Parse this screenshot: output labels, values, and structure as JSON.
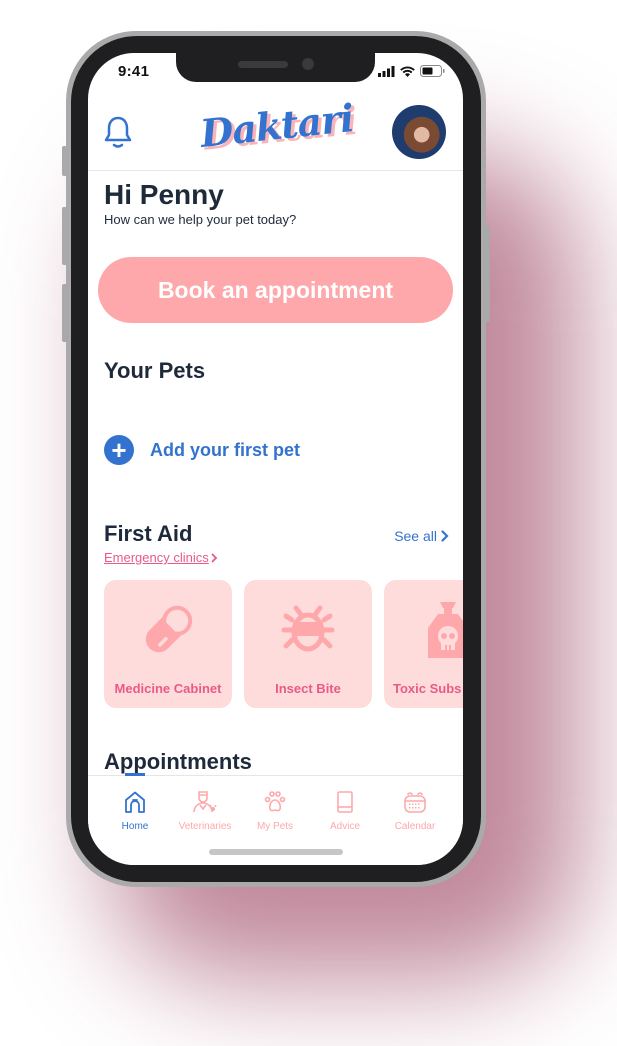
{
  "status_bar": {
    "time": "9:41"
  },
  "header": {
    "logo_text": "Daktari",
    "notification_icon": "bell-icon",
    "avatar_icon": "user-avatar"
  },
  "greeting": {
    "title": "Hi Penny",
    "subtitle": "How can we help your pet today?"
  },
  "book_button": {
    "label": "Book an appointment"
  },
  "pets": {
    "title": "Your Pets",
    "add_label": "Add your first pet",
    "add_icon": "plus-circle-icon"
  },
  "first_aid": {
    "title": "First Aid",
    "see_all_label": "See all",
    "emergency_label": "Emergency clinics",
    "cards": [
      {
        "label": "Medicine Cabinet",
        "icon": "pill-icon"
      },
      {
        "label": "Insect Bite",
        "icon": "bug-icon"
      },
      {
        "label": "Toxic Subs",
        "icon": "poison-bottle-icon"
      }
    ]
  },
  "appointments": {
    "title": "Appointments"
  },
  "tabbar": {
    "items": [
      {
        "label": "Home",
        "icon": "home-icon",
        "active": true
      },
      {
        "label": "Veterinaries",
        "icon": "vet-icon",
        "active": false
      },
      {
        "label": "My Pets",
        "icon": "paw-icon",
        "active": false
      },
      {
        "label": "Advice",
        "icon": "book-icon",
        "active": false
      },
      {
        "label": "Calendar",
        "icon": "calendar-icon",
        "active": false
      }
    ]
  },
  "colors": {
    "primary_blue": "#3373cf",
    "accent_pink": "#fea8ab",
    "card_bg": "#ffdcdc",
    "card_text": "#ea5a86",
    "text_dark": "#1e2a3a"
  }
}
